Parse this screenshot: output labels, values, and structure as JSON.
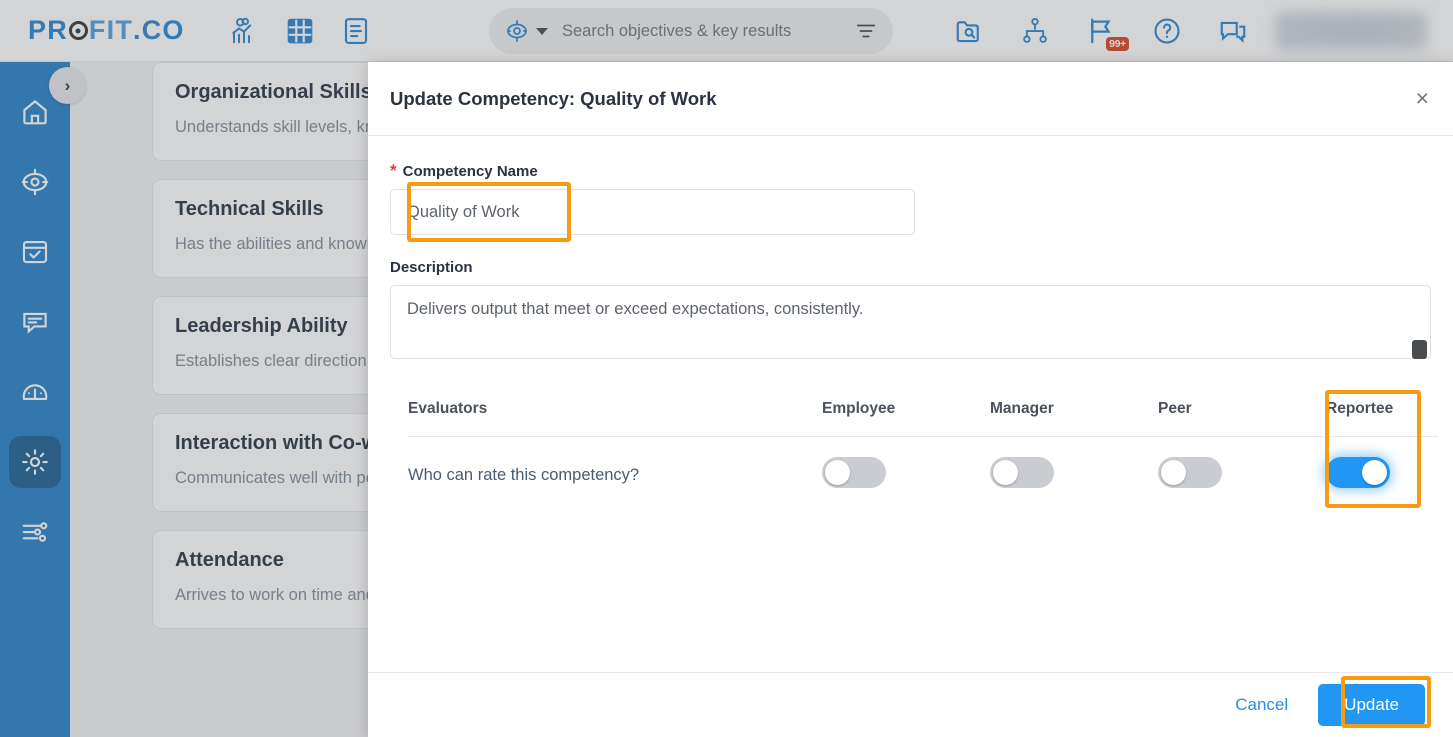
{
  "header": {
    "brand_part1": "PR",
    "brand_part2": "FIT",
    "brand_part3": ".CO",
    "icons": [
      {
        "name": "analytics-icon",
        "label": "Analytics"
      },
      {
        "name": "grid-icon",
        "label": "Grid"
      },
      {
        "name": "document-icon",
        "label": "Documents"
      }
    ],
    "search": {
      "placeholder": "Search objectives & key results",
      "type_icon": "target-icon",
      "dropdown_icon": "caret-down-icon",
      "filter_icon": "filter-icon"
    },
    "right_icons": [
      {
        "name": "folder-search-icon",
        "label": "Search Folder"
      },
      {
        "name": "org-chart-icon",
        "label": "Org Chart"
      },
      {
        "name": "flag-icon",
        "label": "Notifications",
        "badge": "99+"
      },
      {
        "name": "help-icon",
        "label": "Help"
      },
      {
        "name": "chat-icon",
        "label": "Chat"
      }
    ]
  },
  "sidebar": {
    "expander_icon": "chevron-right-icon",
    "expander_label": "›",
    "items": [
      {
        "name": "sidebar-item-home",
        "icon": "home-icon",
        "label": "Home",
        "active": false
      },
      {
        "name": "sidebar-item-objectives",
        "icon": "target-icon",
        "label": "Objectives",
        "active": false
      },
      {
        "name": "sidebar-item-tasks",
        "icon": "calendar-check-icon",
        "label": "Tasks",
        "active": false
      },
      {
        "name": "sidebar-item-feedback",
        "icon": "chat-bubble-icon",
        "label": "Feedback",
        "active": false
      },
      {
        "name": "sidebar-item-performance",
        "icon": "gauge-icon",
        "label": "Performance",
        "active": false
      },
      {
        "name": "sidebar-item-settings",
        "icon": "gear-icon",
        "label": "Settings",
        "active": true
      },
      {
        "name": "sidebar-item-preferences",
        "icon": "sliders-icon",
        "label": "Preferences",
        "active": false
      }
    ]
  },
  "background_cards": [
    {
      "title": "Organizational Skills",
      "desc": "Understands skill levels, knowledge and competencies needed to meet business needs. Works to develop them."
    },
    {
      "title": "Technical Skills",
      "desc": "Has the abilities and knowledge required for the role and works towards continuously upgrading the same."
    },
    {
      "title": "Leadership Ability",
      "desc": "Establishes clear direction and motivates the team towards a clearly defined goal."
    },
    {
      "title": "Interaction with Co-workers",
      "desc": "Communicates well with peers and collaborates effectively."
    },
    {
      "title": "Attendance",
      "desc": "Arrives to work on time and informs of planned absence with advance notice."
    }
  ],
  "modal": {
    "title": "Update Competency: Quality of Work",
    "close_label": "×",
    "name_field": {
      "label": "Competency Name",
      "required_mark": "*",
      "value": "Quality of Work",
      "placeholder": "Competency Name"
    },
    "description_field": {
      "label": "Description",
      "value": "Delivers output that meet or exceed expectations, consistently.",
      "placeholder": "Description"
    },
    "evaluators": {
      "columns": [
        "Evaluators",
        "Employee",
        "Manager",
        "Peer",
        "Reportee"
      ],
      "question": "Who can rate this competency?",
      "toggles": [
        {
          "name": "toggle-employee",
          "column": "Employee",
          "on": false
        },
        {
          "name": "toggle-manager",
          "column": "Manager",
          "on": false
        },
        {
          "name": "toggle-peer",
          "column": "Peer",
          "on": false
        },
        {
          "name": "toggle-reportee",
          "column": "Reportee",
          "on": true
        }
      ]
    },
    "footer": {
      "cancel_label": "Cancel",
      "update_label": "Update"
    }
  },
  "colors": {
    "brand_blue": "#1f7fd0",
    "sidebar_blue": "#1b7ac4",
    "sidebar_active": "#10588f",
    "accent_blue": "#2196f3",
    "highlight_orange": "#f79c12",
    "badge_red": "#d93a15",
    "required_red": "#e23b3b"
  }
}
